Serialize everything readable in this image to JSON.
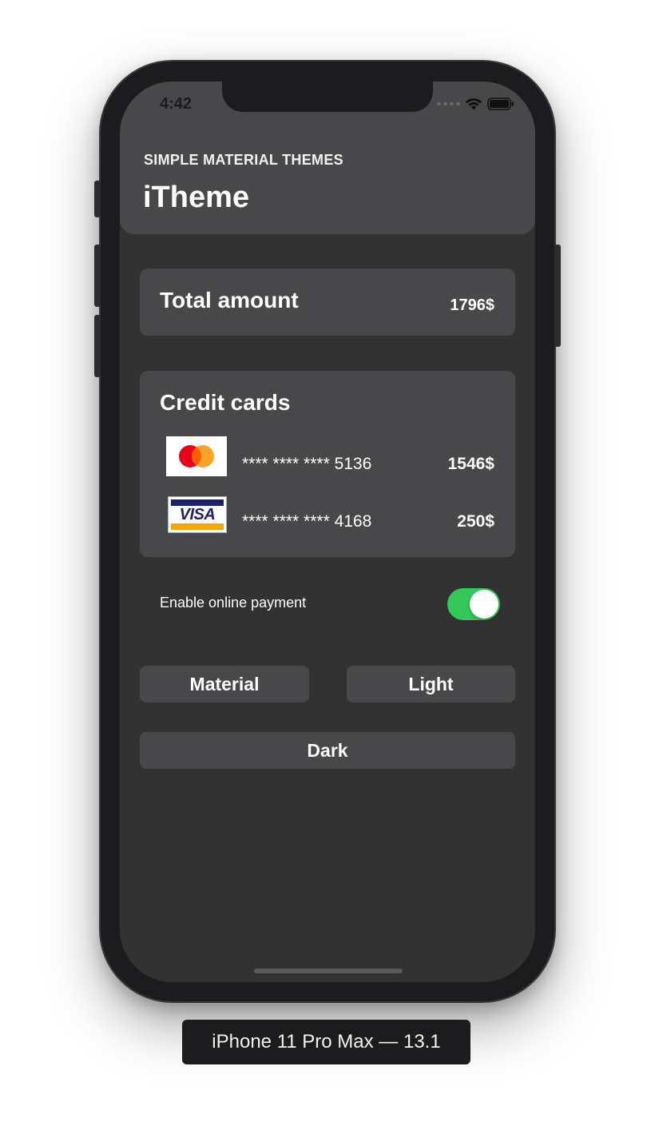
{
  "status_bar": {
    "time": "4:42"
  },
  "header": {
    "eyebrow": "SIMPLE MATERIAL THEMES",
    "title": "iTheme"
  },
  "total": {
    "label": "Total amount",
    "value": "1796$"
  },
  "credit_cards": {
    "title": "Credit cards",
    "items": [
      {
        "brand": "mastercard",
        "number": "**** **** **** 5136",
        "amount": "1546$"
      },
      {
        "brand": "visa",
        "number": "**** **** **** 4168",
        "amount": "250$",
        "logo_text": "VISA"
      }
    ]
  },
  "online_payment": {
    "label": "Enable online payment",
    "enabled": true
  },
  "theme_buttons": {
    "material": "Material",
    "light": "Light",
    "dark": "Dark"
  },
  "device_label": "iPhone 11 Pro Max — 13.1",
  "colors": {
    "accent_toggle": "#34c759",
    "card_background": "#48484a",
    "screen_background": "#323232"
  }
}
